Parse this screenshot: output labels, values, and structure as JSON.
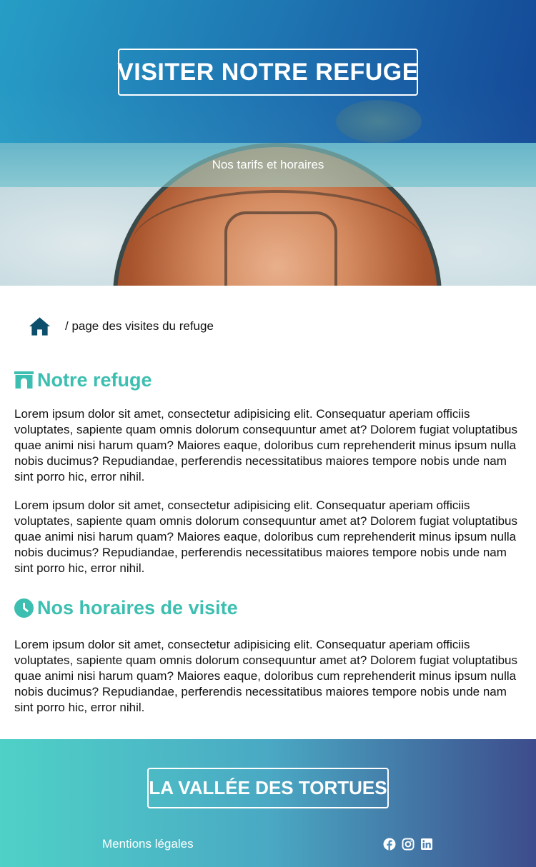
{
  "hero": {
    "title": "VISITER NOTRE REFUGE",
    "subtitle": "Nos tarifs et horaires"
  },
  "breadcrumb": {
    "home_icon": "home-icon",
    "path_text": "/ page des visites du refuge"
  },
  "sections": [
    {
      "icon": "archway-icon",
      "title": "Notre refuge",
      "paragraphs": [
        "Lorem ipsum dolor sit amet, consectetur adipisicing elit. Consequatur aperiam officiis voluptates, sapiente quam omnis dolorum consequuntur amet at? Dolorem fugiat voluptatibus quae animi nisi harum quam? Maiores eaque, doloribus cum reprehenderit minus ipsum nulla nobis ducimus? Repudiandae, perferendis necessitatibus maiores tempore nobis unde nam sint porro hic, error nihil.",
        "Lorem ipsum dolor sit amet, consectetur adipisicing elit. Consequatur aperiam officiis voluptates, sapiente quam omnis dolorum consequuntur amet at? Dolorem fugiat voluptatibus quae animi nisi harum quam? Maiores eaque, doloribus cum reprehenderit minus ipsum nulla nobis ducimus? Repudiandae, perferendis necessitatibus maiores tempore nobis unde nam sint porro hic, error nihil."
      ]
    },
    {
      "icon": "clock-icon",
      "title": "Nos horaires de visite",
      "paragraphs": [
        "Lorem ipsum dolor sit amet, consectetur adipisicing elit. Consequatur aperiam officiis voluptates, sapiente quam omnis dolorum consequuntur amet at? Dolorem fugiat voluptatibus quae animi nisi harum quam? Maiores eaque, doloribus cum reprehenderit minus ipsum nulla nobis ducimus? Repudiandae, perferendis necessitatibus maiores tempore nobis unde nam sint porro hic, error nihil."
      ]
    }
  ],
  "footer": {
    "brand": "LA VALLÉE DES TORTUES",
    "legal_link": "Mentions légales",
    "socials": [
      "facebook-icon",
      "instagram-icon",
      "linkedin-icon"
    ]
  },
  "colors": {
    "accent": "#3cbfb0",
    "home_icon": "#0b4f6c",
    "footer_start": "#4fd1c7",
    "footer_end": "#3d4c8c"
  }
}
